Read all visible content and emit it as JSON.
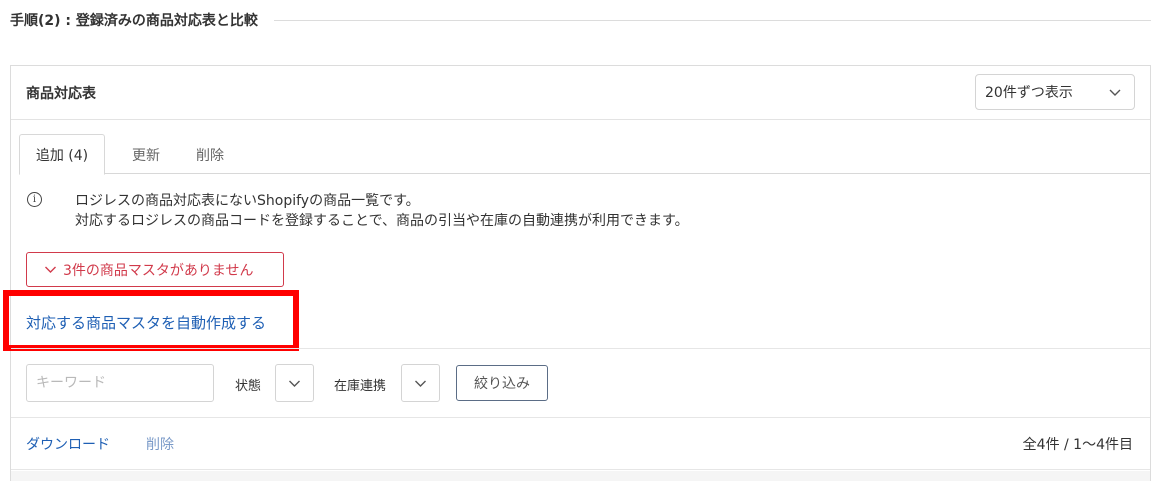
{
  "section": {
    "title": "手順(2) : 登録済みの商品対応表と比較"
  },
  "card": {
    "title": "商品対応表",
    "per_page": {
      "selected": "20件ずつ表示"
    }
  },
  "tabs": [
    {
      "label": "追加 (4)",
      "active": true
    },
    {
      "label": "更新",
      "active": false
    },
    {
      "label": "削除",
      "active": false
    }
  ],
  "info": {
    "icon": "info-icon",
    "line1": "ロジレスの商品対応表にないShopifyの商品一覧です。",
    "line2": "対応するロジレスの商品コードを登録することで、商品の引当や在庫の自動連携が利用できます。"
  },
  "warning": {
    "label": "3件の商品マスタがありません",
    "color": "#d13a4b"
  },
  "auto_create": {
    "label": "対応する商品マスタを自動作成する",
    "color": "#1e5fb4"
  },
  "highlight": {
    "color": "#ff0000"
  },
  "filters": {
    "keyword_placeholder": "キーワード",
    "keyword_value": "",
    "status_label": "状態",
    "stock_sync_label": "在庫連携",
    "filter_button": "絞り込み"
  },
  "actions": {
    "download": "ダウンロード",
    "delete": "削除",
    "count": "全4件 / 1〜4件目"
  }
}
